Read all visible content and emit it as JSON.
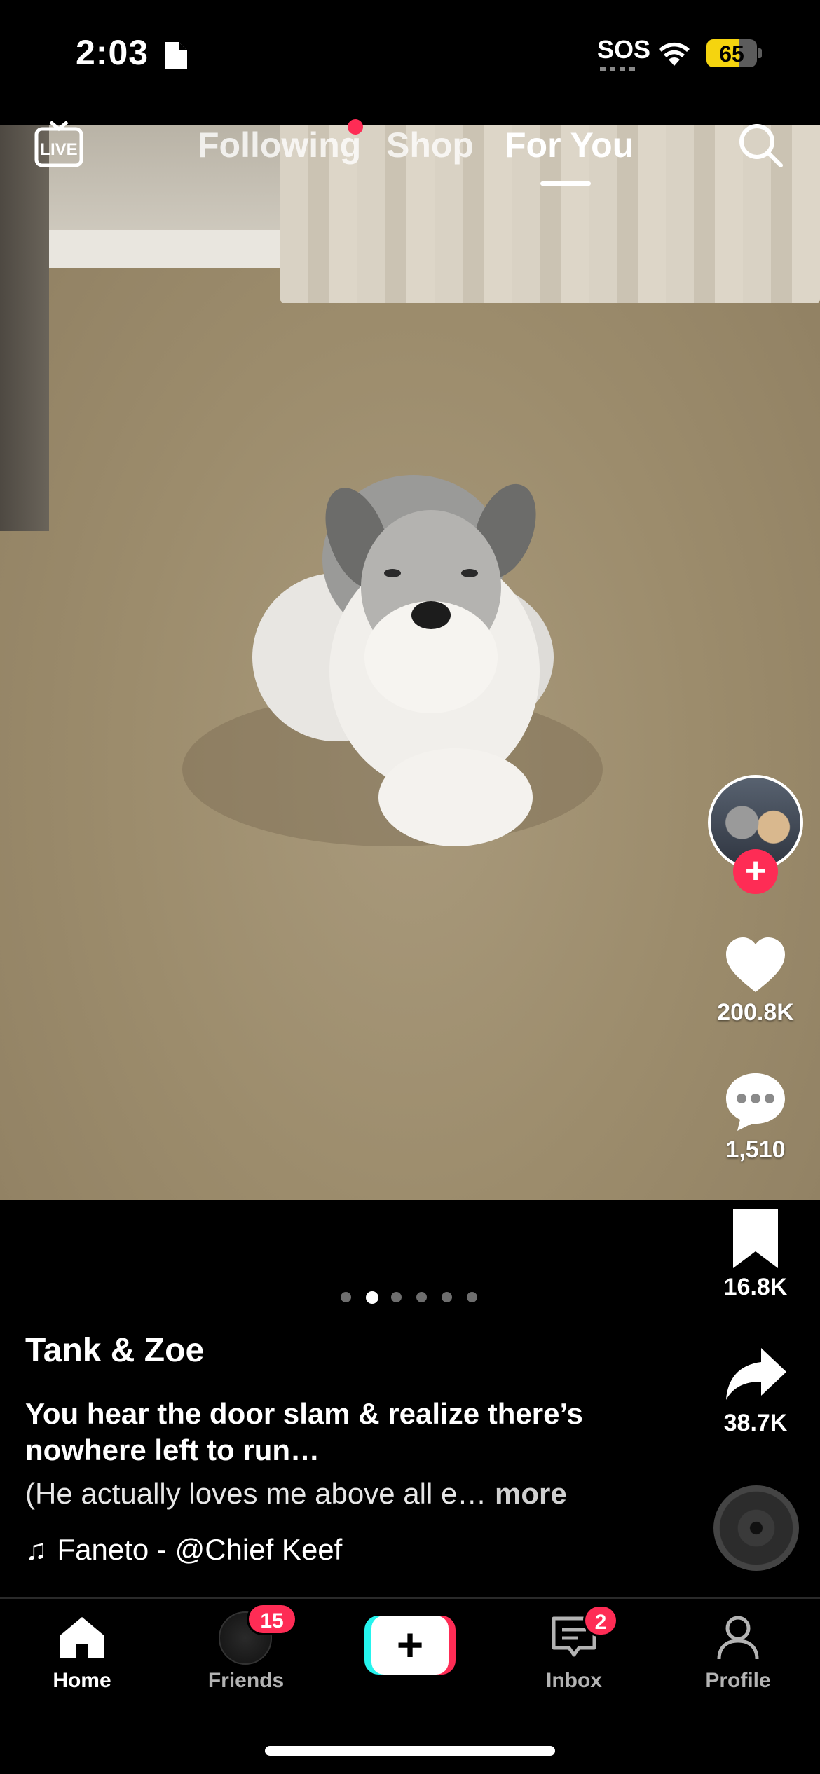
{
  "status_bar": {
    "time": "2:03",
    "sos": "SOS",
    "battery_percent": "65",
    "battery_level": 0.65,
    "battery_color": "#f5d40f"
  },
  "top_nav": {
    "tabs": [
      {
        "label": "Following",
        "has_dot": true
      },
      {
        "label": "Shop"
      },
      {
        "label": "For You",
        "active": true
      }
    ],
    "icons": [
      "live-icon",
      "search-icon"
    ]
  },
  "actions": {
    "likes": "200.8K",
    "comments": "1,510",
    "saves": "16.8K",
    "shares": "38.7K"
  },
  "carousel": {
    "count": 6,
    "active_index": 1
  },
  "post": {
    "author": "Tank & Zoe",
    "title": "You hear the door slam & realize there’s nowhere left to run…",
    "description": "(He actually loves me above all e…",
    "more_label": "more",
    "music": "Faneto - @Chief Keef"
  },
  "bottom_nav": {
    "home": "Home",
    "friends": "Friends",
    "friends_badge": "15",
    "inbox": "Inbox",
    "inbox_badge": "2",
    "profile": "Profile",
    "create_symbol": "+"
  },
  "colors": {
    "accent": "#fe2c55",
    "create_cyan": "#25f4ee"
  }
}
